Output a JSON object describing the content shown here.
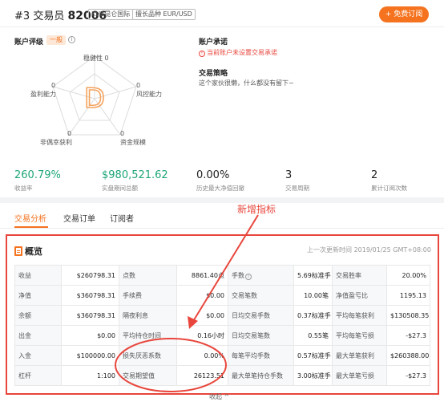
{
  "header": {
    "rank": "#3",
    "trader_label": "交易员",
    "trader_id": "82006",
    "broker_tag": "KVB昆仑国际",
    "symbol_tag": "擅长品种 EUR/USD",
    "subscribe_label": "免费订阅"
  },
  "rating": {
    "title": "账户评级",
    "badge": "一般",
    "grade": "D",
    "axes": [
      {
        "name": "稳健性",
        "value": "0"
      },
      {
        "name": "风控能力",
        "value": "0"
      },
      {
        "name": "资金规模",
        "value": "0"
      },
      {
        "name": "非偶幸获利",
        "value": "0"
      },
      {
        "name": "盈利能力",
        "value": "0"
      }
    ]
  },
  "account": {
    "commitment_title": "账户承诺",
    "commitment_warning": "当前账户未设置交易承诺",
    "strategy_title": "交易策略",
    "strategy_text": "这个家伙很懒，什么都没有留下~"
  },
  "stats": [
    {
      "value": "260.79%",
      "label": "收益率",
      "color": "#1fa67a"
    },
    {
      "value": "$980,521.62",
      "label": "实盘期间总额",
      "color": "#1fa67a"
    },
    {
      "value": "0.00%",
      "label": "历史最大净值回撤",
      "color": "#222222"
    },
    {
      "value": "3",
      "label": "交易周期",
      "color": "#222222"
    },
    {
      "value": "2",
      "label": "累计订阅次数",
      "color": "#222222"
    }
  ],
  "tabs": [
    {
      "label": "交易分析",
      "active": true
    },
    {
      "label": "交易订单",
      "active": false
    },
    {
      "label": "订阅者",
      "active": false
    }
  ],
  "annotation": "新增指标",
  "overview": {
    "title": "概览",
    "updated": "上一次更新时间 2019/01/25 GMT+08:00",
    "rows": [
      [
        [
          "收益",
          "$260798.31"
        ],
        [
          "点数",
          "8861.40点"
        ],
        [
          "手数",
          "5.69标准手"
        ],
        [
          "交易胜率",
          "20.00%"
        ]
      ],
      [
        [
          "净值",
          "$360798.31"
        ],
        [
          "手续费",
          "$0.00"
        ],
        [
          "交易笔数",
          "10.00笔"
        ],
        [
          "净值盈亏比",
          "1195.13"
        ]
      ],
      [
        [
          "余额",
          "$360798.31"
        ],
        [
          "隔夜利息",
          "$0.00"
        ],
        [
          "日均交易手数",
          "0.37标准手"
        ],
        [
          "平均每笔获利",
          "$130508.35"
        ]
      ],
      [
        [
          "出金",
          "$0.00"
        ],
        [
          "平均持仓时间",
          "0.16小时"
        ],
        [
          "日均交易笔数",
          "0.55笔"
        ],
        [
          "平均每笔亏损",
          "-$27.3"
        ]
      ],
      [
        [
          "入金",
          "$100000.00"
        ],
        [
          "损失厌恶系数",
          "0.00%"
        ],
        [
          "每笔平均手数",
          "0.57标准手"
        ],
        [
          "最大单笔获利",
          "$260388.00"
        ]
      ],
      [
        [
          "杠杆",
          "1:100"
        ],
        [
          "交易期望值",
          "26123.51"
        ],
        [
          "最大单笔持仓手数",
          "3.00标准手"
        ],
        [
          "最大单笔亏损",
          "-$27.3"
        ]
      ]
    ],
    "collapse_label": "收起"
  },
  "colors": {
    "accent": "#f5721f",
    "positive": "#1fa67a",
    "annotation_red": "#e8463c"
  }
}
